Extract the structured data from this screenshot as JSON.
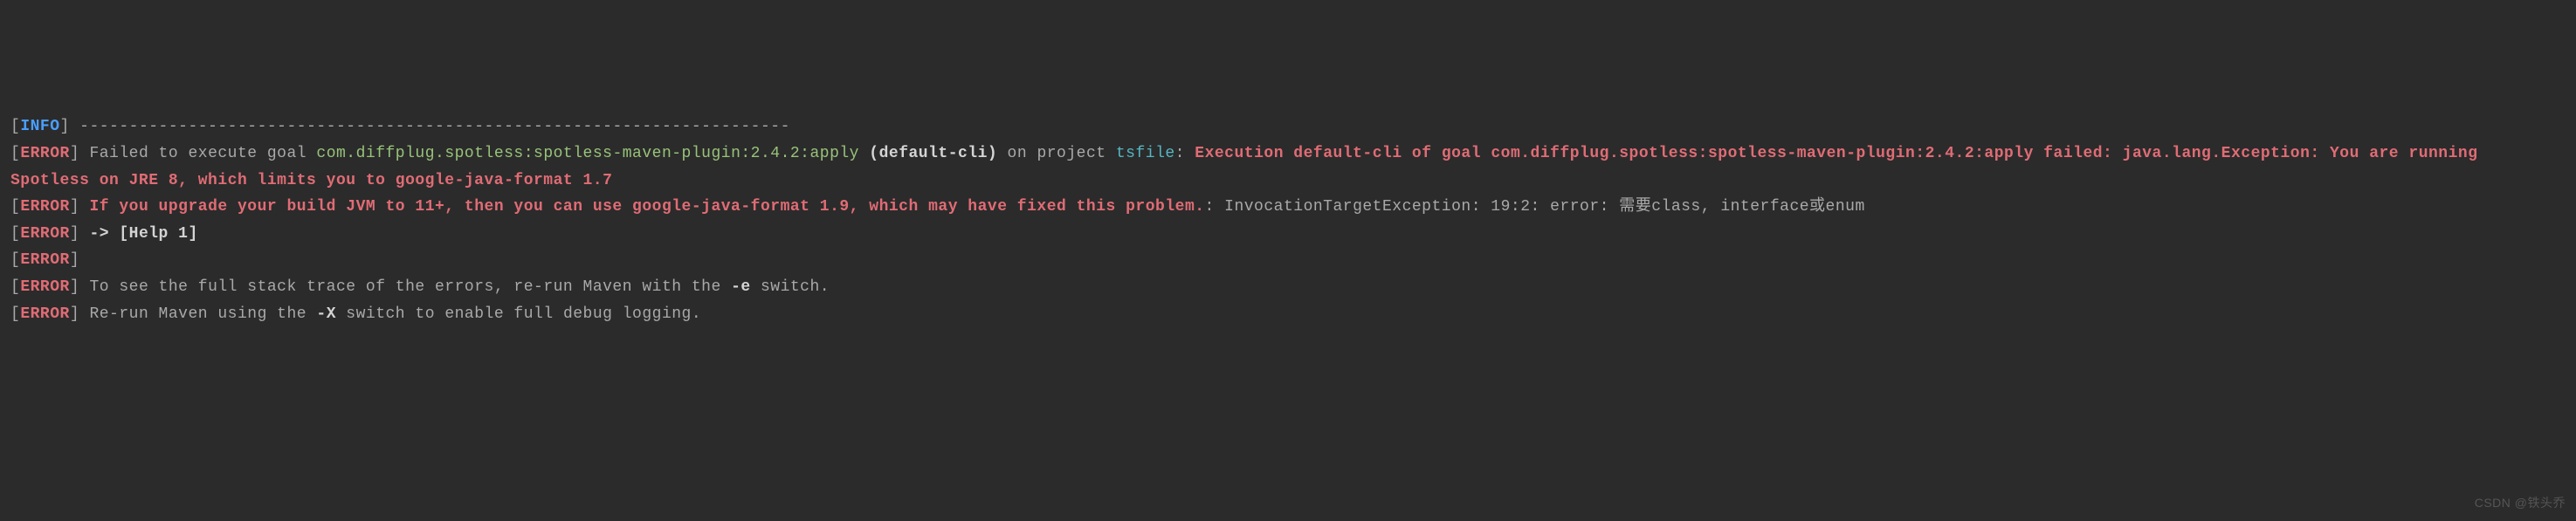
{
  "log": {
    "info_tag": "INFO",
    "error_tag": "ERROR",
    "separator": " ------------------------------------------------------------------------",
    "line1_prefix": " Failed to execute goal ",
    "line1_plugin": "com.diffplug.spotless:spotless-maven-plugin:2.4.2:apply",
    "line1_default_cli": " (default-cli)",
    "line1_on_project": " on project ",
    "line1_project": "tsfile",
    "line1_colon": ": ",
    "line1_error_msg": "Execution default-cli of goal com.diffplug.spotless:spotless-maven-plugin:2.4.2:apply failed: java.lang.Exception: You are running Spotless on JRE 8, which limits you to google-java-format 1.7",
    "line2_error_msg": " If you upgrade your build JVM to 11+, then you can use google-java-format 1.9, which may have fixed this problem.",
    "line2_suffix": ": InvocationTargetException: 19:2: error: 需要class, interface或enum",
    "line3_help": " -> [Help 1]",
    "line4_empty": "",
    "line5_stacktrace": " To see the full stack trace of the errors, re-run Maven with the ",
    "line5_switch": "-e",
    "line5_suffix": " switch.",
    "line6_rerun": " Re-run Maven using the ",
    "line6_switch": "-X",
    "line6_suffix": " switch to enable full debug logging."
  },
  "watermark": "CSDN @铁头乔"
}
